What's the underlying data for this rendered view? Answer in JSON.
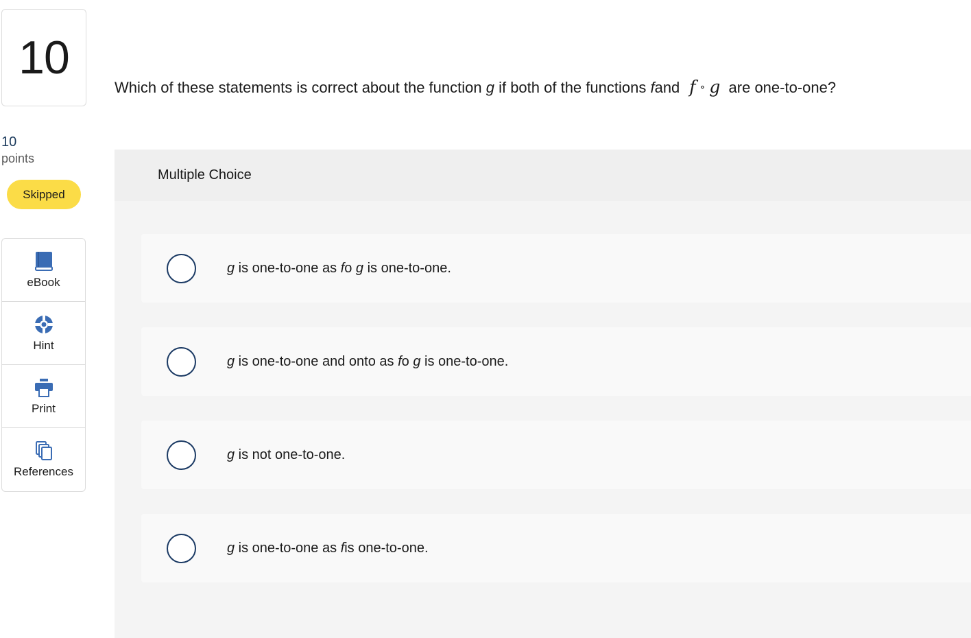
{
  "question_number": "10",
  "points": {
    "value": "10",
    "label": "points"
  },
  "status": "Skipped",
  "tools": [
    {
      "label": "eBook",
      "icon": "book-icon"
    },
    {
      "label": "Hint",
      "icon": "lifebuoy-icon"
    },
    {
      "label": "Print",
      "icon": "printer-icon"
    },
    {
      "label": "References",
      "icon": "documents-icon"
    }
  ],
  "question": {
    "part1": "Which of these statements is correct about the function ",
    "var_g": "g",
    "part2": " if both of the functions ",
    "var_f": "f",
    "part3": "and",
    "expr_f": "f",
    "expr_op": "∘",
    "expr_g": "g",
    "part4": " are one-to-one?"
  },
  "answer_panel": {
    "title": "Multiple Choice"
  },
  "choices": [
    {
      "g": "g",
      "rest1": " is one-to-one as ",
      "f": "f",
      "op": "o ",
      "g2": "g",
      "rest2": " is one-to-one."
    },
    {
      "g": "g",
      "rest1": " is one-to-one and onto as ",
      "f": "f",
      "op": "o ",
      "g2": "g",
      "rest2": " is one-to-one."
    },
    {
      "g": "g",
      "rest1": " is not one-to-one."
    },
    {
      "g": "g",
      "rest1": " is one-to-one as ",
      "f": "f",
      "rest2": "is one-to-one."
    }
  ],
  "colors": {
    "accent": "#1b3a64",
    "badge": "#fbdc47",
    "icon_blue": "#3a6cb4"
  }
}
